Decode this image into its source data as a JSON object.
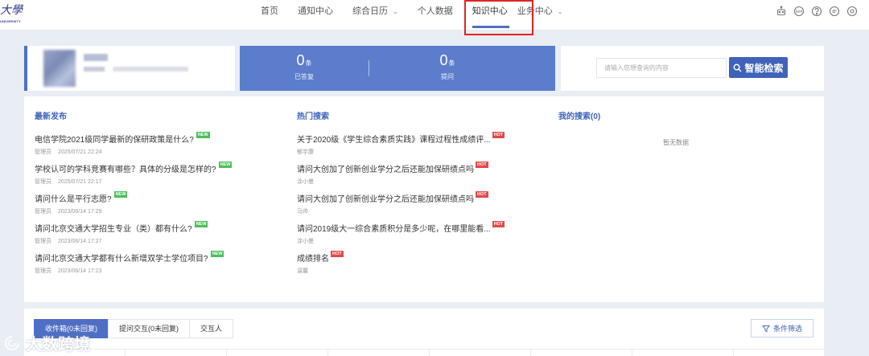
{
  "logo": {
    "name_cn": "大學",
    "name_en": "UNIVERSITY"
  },
  "nav": {
    "items": [
      {
        "label": "首页",
        "dropdown": false,
        "active": false
      },
      {
        "label": "通知中心",
        "dropdown": false,
        "active": false
      },
      {
        "label": "综合日历",
        "dropdown": true,
        "active": false
      },
      {
        "label": "个人数据",
        "dropdown": false,
        "active": false
      },
      {
        "label": "知识中心",
        "dropdown": false,
        "active": true
      },
      {
        "label": "业务中心",
        "dropdown": true,
        "active": false
      }
    ],
    "highlight_color": "#e02424"
  },
  "header_icons": [
    "robot-icon",
    "badge-icon",
    "help-icon",
    "chat-icon",
    "settings-icon"
  ],
  "stats": {
    "answered": {
      "value": "0",
      "unit": "条",
      "label": "已答复"
    },
    "asked": {
      "value": "0",
      "unit": "条",
      "label": "提问"
    }
  },
  "search": {
    "placeholder": "请输入您想查询的内容",
    "button_label": "智能检索"
  },
  "latest": {
    "title": "最新发布",
    "items": [
      {
        "question": "电信学院2021级同学最新的保研政策是什么?",
        "badge": "NEW",
        "author": "管理员",
        "time": "2025/07/21 22:24"
      },
      {
        "question": "学校认可的学科竞赛有哪些？具体的分级是怎样的?",
        "badge": "NEW",
        "author": "管理员",
        "time": "2025/07/21 22:17"
      },
      {
        "question": "请问什么是平行志愿?",
        "badge": "NEW",
        "author": "管理员",
        "time": "2023/06/14 17:29"
      },
      {
        "question": "请问北京交通大学招生专业（类）都有什么?",
        "badge": "NEW",
        "author": "管理员",
        "time": "2023/06/14 17:27"
      },
      {
        "question": "请问北京交通大学都有什么新增双学士学位项目?",
        "badge": "NEW",
        "author": "管理员",
        "time": "2023/06/14 17:23"
      }
    ]
  },
  "hot": {
    "title": "热门搜索",
    "items": [
      {
        "question": "关于2020级《学生综合素质实践》课程过程性成绩评...",
        "badge": "HOT",
        "author": "郁宇康"
      },
      {
        "question": "请问大创加了创新创业学分之后还能加保研绩点吗",
        "badge": "HOT",
        "author": "涂小曼"
      },
      {
        "question": "请问大创加了创新创业学分之后还能加保研绩点吗",
        "badge": "HOT",
        "author": "马帅"
      },
      {
        "question": "请问2019级大一综合素质积分是多少呢，在哪里能看...",
        "badge": "HOT",
        "author": "涂小曼"
      },
      {
        "question": "成绩排名",
        "badge": "HOT",
        "author": "温馨"
      }
    ]
  },
  "mine": {
    "title": "我的搜索(0)",
    "empty_text": "暂无数据"
  },
  "inbox": {
    "tabs": [
      {
        "label": "收件箱(0未回复)",
        "active": true
      },
      {
        "label": "提问交互(0未回复)",
        "active": false
      },
      {
        "label": "交互人",
        "active": false
      }
    ],
    "filter_label": "条件筛选"
  },
  "watermark": "大数跨境",
  "colors": {
    "primary": "#4e6fc4",
    "stats_bg": "#5b7dcc",
    "new_badge": "#4cc05a",
    "hot_badge": "#e24a4a",
    "page_bg": "#e9eef5"
  }
}
